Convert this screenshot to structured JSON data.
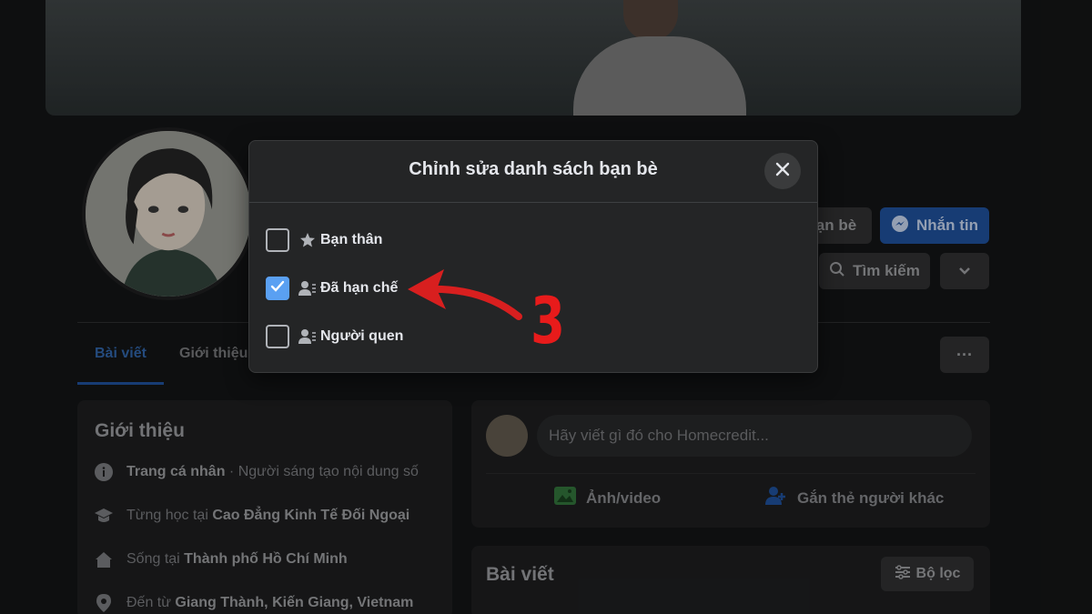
{
  "modal": {
    "title": "Chỉnh sửa danh sách bạn bè",
    "options": [
      {
        "label": "Bạn thân",
        "checked": false,
        "icon": "star-icon"
      },
      {
        "label": "Đã hạn chế",
        "checked": true,
        "icon": "friend-list-icon"
      },
      {
        "label": "Người quen",
        "checked": false,
        "icon": "friend-list-icon"
      }
    ]
  },
  "profile_actions": {
    "friends_label": "ạn bè",
    "message_label": "Nhắn tin",
    "search_label": "Tìm kiếm"
  },
  "tabs": {
    "posts": "Bài viết",
    "about": "Giới thiệu"
  },
  "intro": {
    "title": "Giới thiệu",
    "rows": [
      {
        "bold": "Trang cá nhân",
        "text": " · Người sáng tạo nội dung số"
      },
      {
        "prefix": "Từng học tại ",
        "bold": "Cao Đẳng Kinh Tế Đối Ngoại"
      },
      {
        "prefix": "Sống tại ",
        "bold": "Thành phố Hồ Chí Minh"
      },
      {
        "prefix": "Đến từ ",
        "bold": "Giang Thành, Kiến Giang, Vietnam"
      }
    ]
  },
  "composer": {
    "placeholder": "Hãy viết gì đó cho Homecredit...",
    "photo_video": "Ảnh/video",
    "tag_people": "Gắn thẻ người khác"
  },
  "posts": {
    "title": "Bài viết",
    "filter_label": "Bộ lọc"
  },
  "more_label": "···",
  "annotation": {
    "step": "3",
    "color": "#e81b1b"
  },
  "colors": {
    "accent": "#1d4a8e",
    "checkbox": "#5aa0f2"
  }
}
